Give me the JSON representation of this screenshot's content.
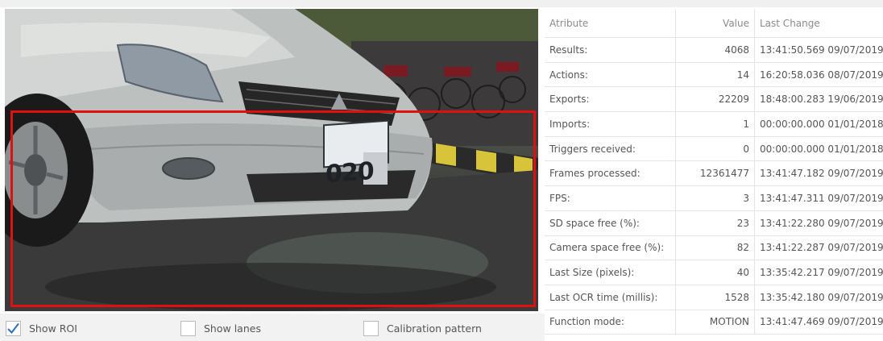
{
  "options": [
    {
      "label": "Show ROI",
      "checked": true
    },
    {
      "label": "Show lanes",
      "checked": false
    },
    {
      "label": "Calibration pattern",
      "checked": false
    }
  ],
  "roi_color": "#e01010",
  "camera": {
    "plate_text": "020"
  },
  "table": {
    "headers": {
      "attribute": "Atribute",
      "value": "Value",
      "last_change": "Last Change"
    },
    "rows": [
      {
        "attribute": "Results:",
        "value": "4068",
        "last_change": "13:41:50.569 09/07/2019"
      },
      {
        "attribute": "Actions:",
        "value": "14",
        "last_change": "16:20:58.036 08/07/2019"
      },
      {
        "attribute": "Exports:",
        "value": "22209",
        "last_change": "18:48:00.283 19/06/2019"
      },
      {
        "attribute": "Imports:",
        "value": "1",
        "last_change": "00:00:00.000 01/01/2018"
      },
      {
        "attribute": "Triggers received:",
        "value": "0",
        "last_change": "00:00:00.000 01/01/2018"
      },
      {
        "attribute": "Frames processed:",
        "value": "12361477",
        "last_change": "13:41:47.182 09/07/2019"
      },
      {
        "attribute": "FPS:",
        "value": "3",
        "last_change": "13:41:47.311 09/07/2019"
      },
      {
        "attribute": "SD space free (%):",
        "value": "23",
        "last_change": "13:41:22.280 09/07/2019"
      },
      {
        "attribute": "Camera space free (%):",
        "value": "82",
        "last_change": "13:41:22.287 09/07/2019"
      },
      {
        "attribute": "Last Size (pixels):",
        "value": "40",
        "last_change": "13:35:42.217 09/07/2019"
      },
      {
        "attribute": "Last OCR time (millis):",
        "value": "1528",
        "last_change": "13:35:42.180 09/07/2019"
      },
      {
        "attribute": "Function mode:",
        "value": "MOTION",
        "last_change": "13:41:47.469 09/07/2019"
      }
    ]
  }
}
